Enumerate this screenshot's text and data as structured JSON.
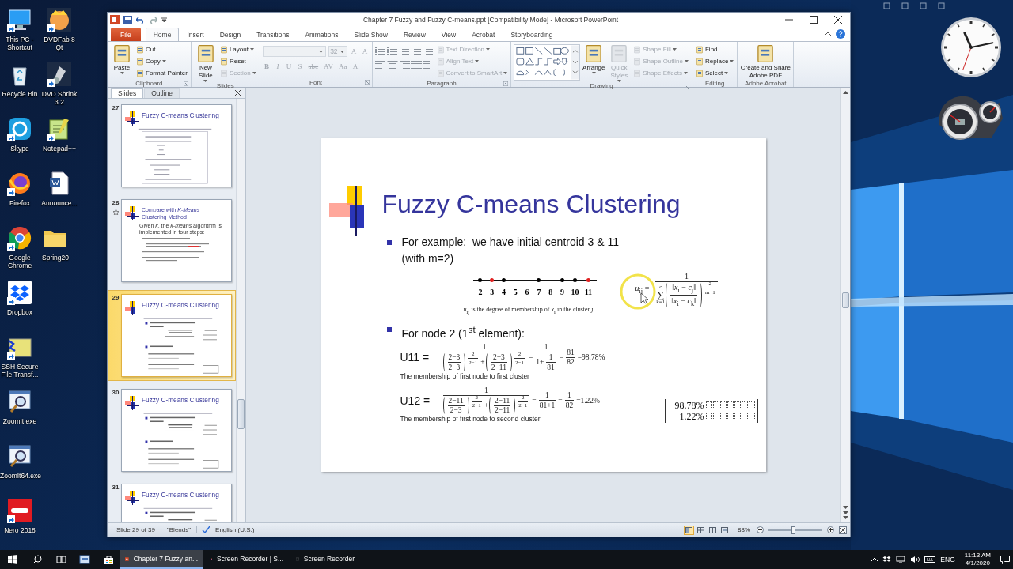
{
  "desktop": {
    "icons": [
      {
        "label": "This PC - Shortcut",
        "kind": "pc",
        "shortcut": true
      },
      {
        "label": "Recycle Bin",
        "kind": "recycle",
        "shortcut": false
      },
      {
        "label": "Skype",
        "kind": "skype",
        "shortcut": true
      },
      {
        "label": "Firefox",
        "kind": "firefox",
        "shortcut": true
      },
      {
        "label": "Google Chrome",
        "kind": "chrome",
        "shortcut": true
      },
      {
        "label": "Dropbox",
        "kind": "dropbox",
        "shortcut": true
      },
      {
        "label": "SSH Secure File Transf...",
        "kind": "ssh",
        "shortcut": true
      },
      {
        "label": "ZoomIt.exe",
        "kind": "zoomit",
        "shortcut": false
      },
      {
        "label": "ZoomIt64.exe",
        "kind": "zoomit",
        "shortcut": false
      },
      {
        "label": "Nero 2018",
        "kind": "nero",
        "shortcut": true
      },
      {
        "label": "DVDFab 8 Qt",
        "kind": "dvdfab",
        "shortcut": true
      },
      {
        "label": "DVD Shrink 3.2",
        "kind": "dvdshrink",
        "shortcut": true
      },
      {
        "label": "Notepad++",
        "kind": "notepad",
        "shortcut": true
      },
      {
        "label": "Announce...",
        "kind": "word",
        "shortcut": false
      },
      {
        "label": "Spring20",
        "kind": "folder",
        "shortcut": false
      }
    ]
  },
  "window": {
    "title": "Chapter 7 Fuzzy and Fuzzy C-means.ppt [Compatibility Mode] - Microsoft PowerPoint"
  },
  "ribbon": {
    "tabs": [
      {
        "label": "File",
        "kind": "file",
        "selected": false
      },
      {
        "label": "Home",
        "kind": "tab",
        "selected": true
      },
      {
        "label": "Insert",
        "kind": "tab",
        "selected": false
      },
      {
        "label": "Design",
        "kind": "tab",
        "selected": false
      },
      {
        "label": "Transitions",
        "kind": "tab",
        "selected": false
      },
      {
        "label": "Animations",
        "kind": "tab",
        "selected": false
      },
      {
        "label": "Slide Show",
        "kind": "tab",
        "selected": false
      },
      {
        "label": "Review",
        "kind": "tab",
        "selected": false
      },
      {
        "label": "View",
        "kind": "tab",
        "selected": false
      },
      {
        "label": "Acrobat",
        "kind": "tab",
        "selected": false
      },
      {
        "label": "Storyboarding",
        "kind": "tab",
        "selected": false
      }
    ],
    "groups": [
      {
        "label": "Clipboard",
        "launcher": true,
        "items": [
          {
            "kind": "large",
            "label": "Paste",
            "dropdown": true,
            "disabled": false
          },
          {
            "kind": "small",
            "label": "Cut",
            "dropdown": false,
            "disabled": false
          },
          {
            "kind": "small",
            "label": "Copy",
            "dropdown": true,
            "disabled": false
          },
          {
            "kind": "small",
            "label": "Format Painter",
            "dropdown": false,
            "disabled": false
          }
        ]
      },
      {
        "label": "Slides",
        "launcher": false,
        "items": [
          {
            "kind": "large",
            "label": "New Slide",
            "dropdown": true,
            "disabled": false
          },
          {
            "kind": "small",
            "label": "Layout",
            "dropdown": true,
            "disabled": false
          },
          {
            "kind": "small",
            "label": "Reset",
            "dropdown": false,
            "disabled": false
          },
          {
            "kind": "small",
            "label": "Section",
            "dropdown": true,
            "disabled": true
          }
        ]
      },
      {
        "label": "Font",
        "launcher": true,
        "items": [
          {
            "kind": "font",
            "size": "32",
            "size_buttons": [
              "A",
              "A"
            ],
            "buttons": [
              "B",
              "I",
              "U",
              "S",
              "abc",
              "AV",
              "Aa",
              "A"
            ],
            "disabled": true
          }
        ]
      },
      {
        "label": "Paragraph",
        "launcher": true,
        "items": [
          {
            "kind": "paragraph"
          },
          {
            "kind": "small",
            "label": "Text Direction",
            "dropdown": true,
            "disabled": true
          },
          {
            "kind": "small",
            "label": "Align Text",
            "dropdown": true,
            "disabled": true
          },
          {
            "kind": "small",
            "label": "Convert to SmartArt",
            "dropdown": true,
            "disabled": true
          }
        ]
      },
      {
        "label": "Drawing",
        "launcher": true,
        "items": [
          {
            "kind": "gallery"
          },
          {
            "kind": "large",
            "label": "Arrange",
            "dropdown": true,
            "disabled": false
          },
          {
            "kind": "large",
            "label": "Quick Styles",
            "dropdown": true,
            "disabled": true
          },
          {
            "kind": "small",
            "label": "Shape Fill",
            "dropdown": true,
            "disabled": true
          },
          {
            "kind": "small",
            "label": "Shape Outline",
            "dropdown": true,
            "disabled": true
          },
          {
            "kind": "small",
            "label": "Shape Effects",
            "dropdown": true,
            "disabled": true
          }
        ]
      },
      {
        "label": "Editing",
        "launcher": false,
        "items": [
          {
            "kind": "small",
            "label": "Find",
            "dropdown": false,
            "disabled": false
          },
          {
            "kind": "small",
            "label": "Replace",
            "dropdown": true,
            "disabled": false
          },
          {
            "kind": "small",
            "label": "Select",
            "dropdown": true,
            "disabled": false
          }
        ]
      },
      {
        "label": "Adobe Acrobat",
        "launcher": false,
        "items": [
          {
            "kind": "large",
            "label": "Create and Share Adobe PDF",
            "dropdown": false,
            "disabled": false
          }
        ]
      }
    ]
  },
  "slides_panel": {
    "tabs": [
      {
        "label": "Slides",
        "selected": true
      },
      {
        "label": "Outline",
        "selected": false
      }
    ],
    "thumbnails": [
      {
        "number": "27",
        "title": "Fuzzy C-means Clustering",
        "kind": "formula",
        "selected": false,
        "animated": false
      },
      {
        "number": "28",
        "title": "Compare with *K-Means* Clustering Method",
        "kind": "list",
        "selected": false,
        "animated": true,
        "bullets": [
          "Given *k*, the *k-means* algorithm is implemented in four steps:"
        ]
      },
      {
        "number": "29",
        "title": "Fuzzy C-means Clustering",
        "kind": "example",
        "selected": true,
        "animated": false
      },
      {
        "number": "30",
        "title": "Fuzzy C-means Clustering",
        "kind": "example",
        "selected": false,
        "animated": false
      },
      {
        "number": "31",
        "title": "Fuzzy C-means Clustering",
        "kind": "example",
        "selected": false,
        "animated": false
      }
    ]
  },
  "slide": {
    "title": "Fuzzy C-means Clustering",
    "bullet_1": "For example:  we have initial centroid 3 & 11 (with m=2)",
    "number_line": [
      {
        "label": "2",
        "dot": true,
        "color": "#000000"
      },
      {
        "label": "3",
        "dot": true,
        "color": "#e02020"
      },
      {
        "label": "4",
        "dot": true,
        "color": "#000000"
      },
      {
        "label": "5",
        "dot": false
      },
      {
        "label": "6",
        "dot": false
      },
      {
        "label": "7",
        "dot": true,
        "color": "#000000"
      },
      {
        "label": "8",
        "dot": false
      },
      {
        "label": "9",
        "dot": true,
        "color": "#000000"
      },
      {
        "label": "10",
        "dot": true,
        "color": "#000000"
      },
      {
        "label": "11",
        "dot": true,
        "color": "#e02020"
      }
    ],
    "caption": "*u*$_{ij}$ is the degree of membership of *x*$_{i}$ in the cluster *j*.",
    "membership": {
      "lhs": "*u*$_{ij}$ =",
      "terms": [
        {
          "kind": "frac",
          "num": [
            {
              "kind": "text",
              "text": "1"
            }
          ],
          "den": [
            {
              "kind": "sum",
              "symbol": "∑",
              "upper": "c",
              "lower": "k=1"
            },
            {
              "kind": "power",
              "base": [
                {
                  "kind": "frac",
                  "num": [
                    {
                      "kind": "text",
                      "text": "‖*x*$_{i}$ − *c*$_{j}$‖"
                    }
                  ],
                  "den": [
                    {
                      "kind": "text",
                      "text": "‖*x*$_{i}$ − *c*$_{k}$‖"
                    }
                  ]
                }
              ],
              "exp": [
                {
                  "kind": "frac",
                  "num": [
                    {
                      "kind": "text",
                      "text": "2"
                    }
                  ],
                  "den": [
                    {
                      "kind": "text",
                      "text": "m−1"
                    }
                  ]
                }
              ]
            }
          ]
        }
      ]
    },
    "bullet_2": "For node 2 (1$^{st}$ element):",
    "equations": [
      {
        "label": "U11 =",
        "note": "The membership of first node to first cluster",
        "terms": [
          {
            "kind": "frac",
            "num": [
              {
                "kind": "text",
                "text": "1"
              }
            ],
            "den": [
              {
                "kind": "power",
                "base": [
                  {
                    "kind": "frac",
                    "num": [
                      {
                        "kind": "text",
                        "text": "2−3"
                      }
                    ],
                    "den": [
                      {
                        "kind": "text",
                        "text": "2−3"
                      }
                    ]
                  }
                ],
                "exp": [
                  {
                    "kind": "frac",
                    "num": [
                      {
                        "kind": "text",
                        "text": "2"
                      }
                    ],
                    "den": [
                      {
                        "kind": "text",
                        "text": "2−1"
                      }
                    ]
                  }
                ]
              },
              {
                "kind": "text",
                "text": "+"
              },
              {
                "kind": "power",
                "base": [
                  {
                    "kind": "frac",
                    "num": [
                      {
                        "kind": "text",
                        "text": "2−3"
                      }
                    ],
                    "den": [
                      {
                        "kind": "text",
                        "text": "2−11"
                      }
                    ]
                  }
                ],
                "exp": [
                  {
                    "kind": "frac",
                    "num": [
                      {
                        "kind": "text",
                        "text": "2"
                      }
                    ],
                    "den": [
                      {
                        "kind": "text",
                        "text": "2−1"
                      }
                    ]
                  }
                ]
              }
            ]
          },
          {
            "kind": "text",
            "text": "="
          },
          {
            "kind": "frac",
            "num": [
              {
                "kind": "text",
                "text": "1"
              }
            ],
            "den": [
              {
                "kind": "text",
                "text": "1+"
              },
              {
                "kind": "frac",
                "num": [
                  {
                    "kind": "text",
                    "text": "1"
                  }
                ],
                "den": [
                  {
                    "kind": "text",
                    "text": "81"
                  }
                ]
              }
            ]
          },
          {
            "kind": "text",
            "text": "="
          },
          {
            "kind": "frac",
            "num": [
              {
                "kind": "text",
                "text": "81"
              }
            ],
            "den": [
              {
                "kind": "text",
                "text": "82"
              }
            ]
          },
          {
            "kind": "text",
            "text": "=98.78%"
          }
        ]
      },
      {
        "label": "U12 =",
        "note": "The membership of first node to second cluster",
        "terms": [
          {
            "kind": "frac",
            "num": [
              {
                "kind": "text",
                "text": "1"
              }
            ],
            "den": [
              {
                "kind": "power",
                "base": [
                  {
                    "kind": "frac",
                    "num": [
                      {
                        "kind": "text",
                        "text": "2−11"
                      }
                    ],
                    "den": [
                      {
                        "kind": "text",
                        "text": "2−3"
                      }
                    ]
                  }
                ],
                "exp": [
                  {
                    "kind": "frac",
                    "num": [
                      {
                        "kind": "text",
                        "text": "2"
                      }
                    ],
                    "den": [
                      {
                        "kind": "text",
                        "text": "2−1"
                      }
                    ]
                  }
                ]
              },
              {
                "kind": "text",
                "text": "+"
              },
              {
                "kind": "power",
                "base": [
                  {
                    "kind": "frac",
                    "num": [
                      {
                        "kind": "text",
                        "text": "2−11"
                      }
                    ],
                    "den": [
                      {
                        "kind": "text",
                        "text": "2−11"
                      }
                    ]
                  }
                ],
                "exp": [
                  {
                    "kind": "frac",
                    "num": [
                      {
                        "kind": "text",
                        "text": "2"
                      }
                    ],
                    "den": [
                      {
                        "kind": "text",
                        "text": "2−1"
                      }
                    ]
                  }
                ]
              }
            ]
          },
          {
            "kind": "text",
            "text": "="
          },
          {
            "kind": "frac",
            "num": [
              {
                "kind": "text",
                "text": "1"
              }
            ],
            "den": [
              {
                "kind": "text",
                "text": "81+1"
              }
            ]
          },
          {
            "kind": "text",
            "text": "="
          },
          {
            "kind": "frac",
            "num": [
              {
                "kind": "text",
                "text": "1"
              }
            ],
            "den": [
              {
                "kind": "text",
                "text": "82"
              }
            ]
          },
          {
            "kind": "text",
            "text": "=1.22%"
          }
        ]
      }
    ],
    "matrix": [
      "98.78%",
      "1.22%"
    ]
  },
  "status_bar": {
    "slide": "Slide 29 of 39",
    "theme": "\"Blends\"",
    "language": "English (U.S.)",
    "views": [
      {
        "kind": "normal",
        "selected": true
      },
      {
        "kind": "sorter",
        "selected": false
      },
      {
        "kind": "reading",
        "selected": false
      },
      {
        "kind": "show",
        "selected": false
      }
    ],
    "zoom": "88%",
    "zoom_slider": {
      "level": 0.45
    }
  },
  "taskbar": {
    "tasks": [
      {
        "label": "Chapter 7 Fuzzy an...",
        "kind": "powerpoint",
        "selected": true
      },
      {
        "label": "Screen Recorder | S...",
        "kind": "browser",
        "selected": false
      },
      {
        "label": "Screen Recorder",
        "kind": "recorder",
        "selected": false
      }
    ],
    "language": "ENG",
    "time": "11:13 AM",
    "date": "4/1/2020"
  }
}
